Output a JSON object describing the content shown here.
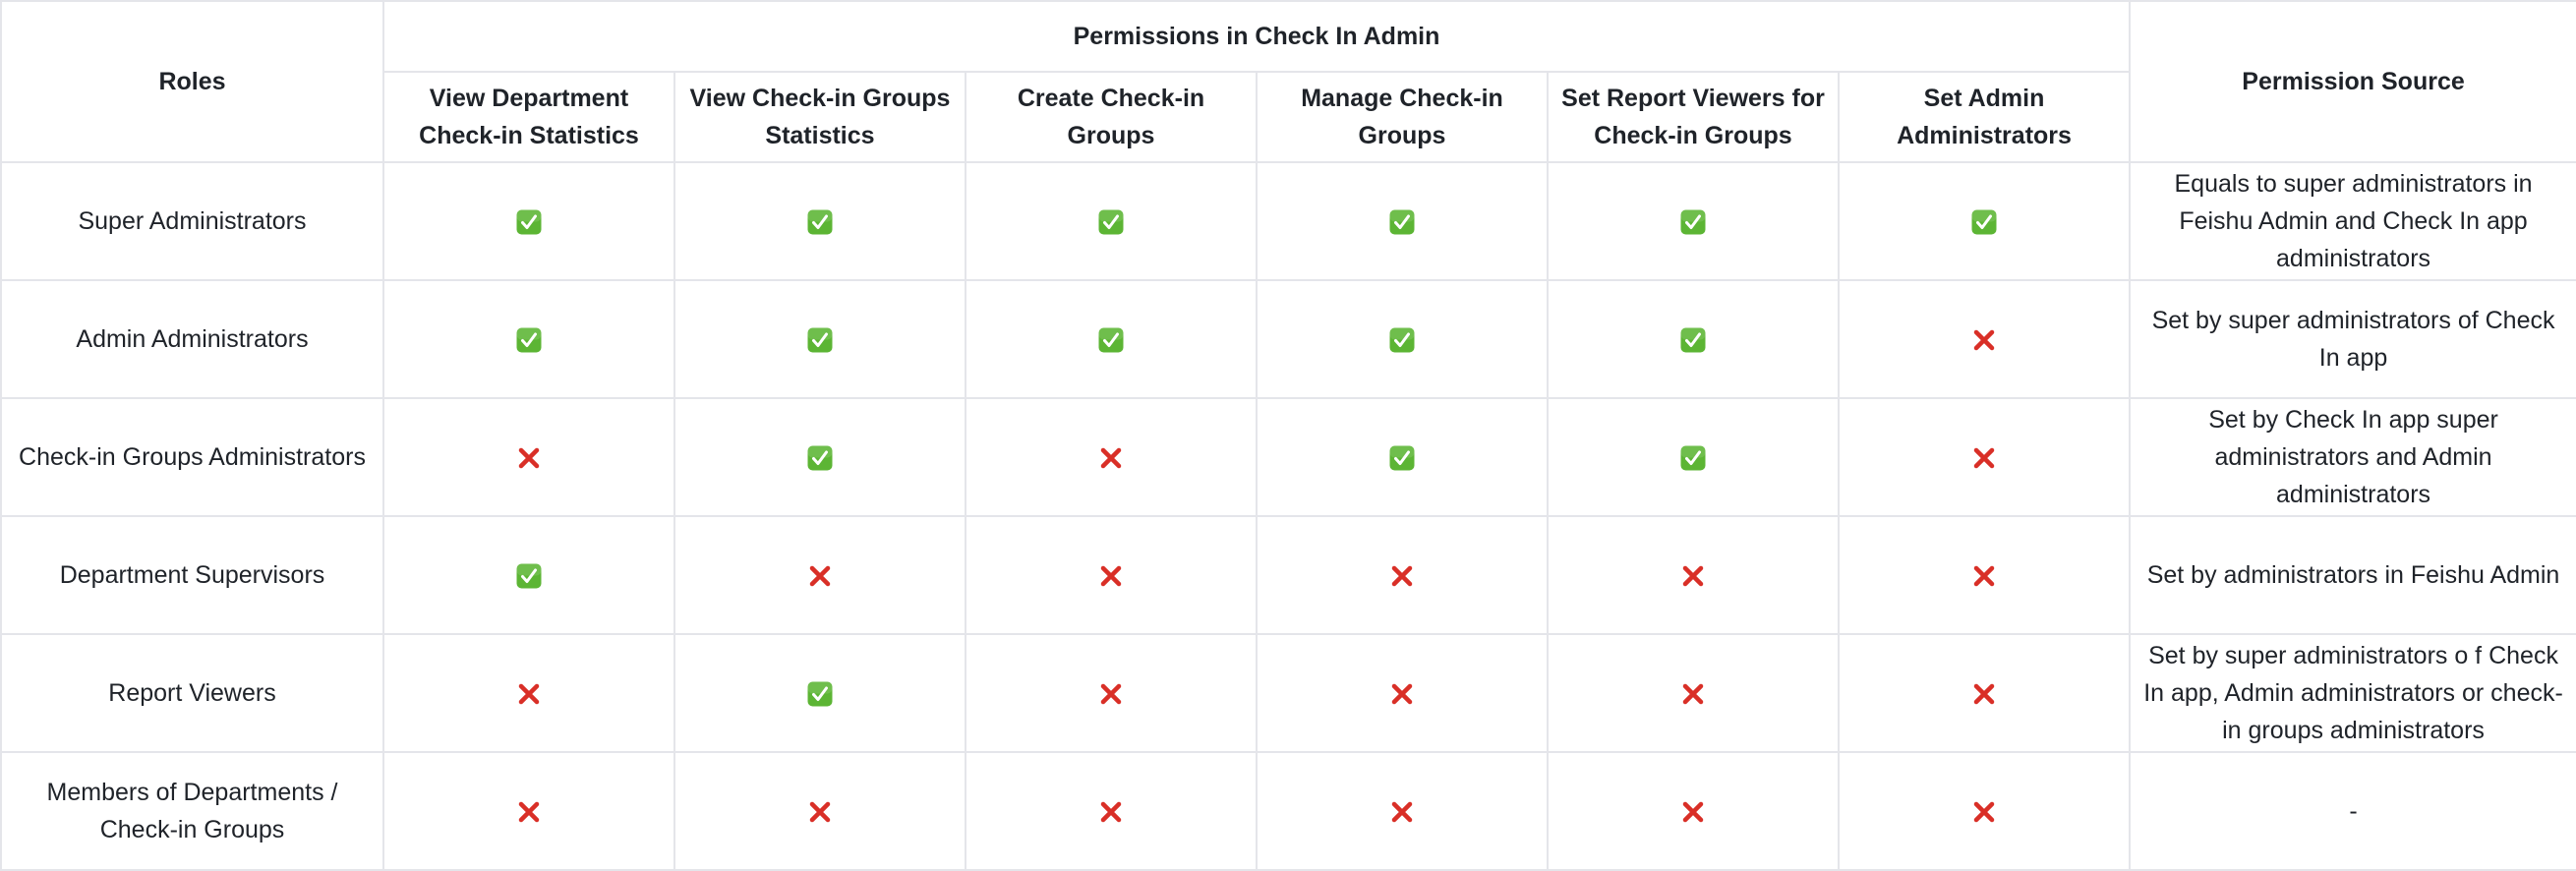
{
  "table": {
    "roles_header": "Roles",
    "permissions_group_header": "Permissions in Check In Admin",
    "source_header": "Permission Source",
    "permission_columns": [
      "View Department Check-in Statistics",
      "View Check-in Groups Statistics",
      "Create Check-in Groups",
      "Manage Check-in Groups",
      "Set Report Viewers for Check-in Groups",
      "Set Admin Administrators"
    ],
    "icons": {
      "granted": "check-mark-button-icon",
      "denied": "cross-mark-icon"
    },
    "colors": {
      "granted": "#5cb534",
      "denied": "#d92f27",
      "border": "#e4e5ea",
      "text": "#1f2329"
    },
    "rows": [
      {
        "role": "Super Administrators",
        "permissions": [
          true,
          true,
          true,
          true,
          true,
          true
        ],
        "source": "Equals to super administrators in Feishu Admin and Check In app administrators"
      },
      {
        "role": "Admin Administrators",
        "permissions": [
          true,
          true,
          true,
          true,
          true,
          false
        ],
        "source": "Set by super administrators of Check In app"
      },
      {
        "role": "Check-in Groups Administrators",
        "permissions": [
          false,
          true,
          false,
          true,
          true,
          false
        ],
        "source": "Set by Check In app super administrators and Admin administrators"
      },
      {
        "role": "Department Supervisors",
        "permissions": [
          true,
          false,
          false,
          false,
          false,
          false
        ],
        "source": "Set by administrators in Feishu Admin"
      },
      {
        "role": "Report Viewers",
        "permissions": [
          false,
          true,
          false,
          false,
          false,
          false
        ],
        "source": "Set by super administrators o f Check In app, Admin administrators or check-in groups administrators"
      },
      {
        "role": "Members of Departments / Check-in Groups",
        "permissions": [
          false,
          false,
          false,
          false,
          false,
          false
        ],
        "source": "-"
      }
    ]
  }
}
